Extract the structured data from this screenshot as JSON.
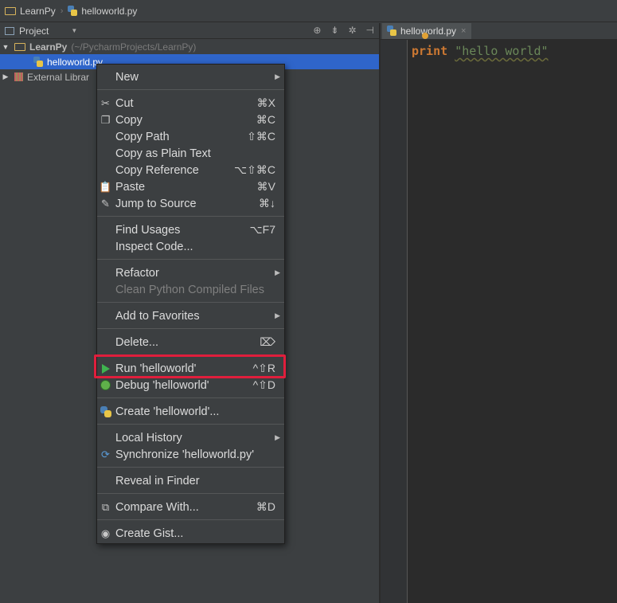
{
  "breadcrumb": {
    "project": "LearnPy",
    "file": "helloworld.py"
  },
  "project_panel": {
    "title": "Project",
    "tree": {
      "root_name": "LearnPy",
      "root_path": "(~/PycharmProjects/LearnPy)",
      "selected_file": "helloworld.py",
      "external_libraries": "External Librar"
    }
  },
  "editor": {
    "tab_label": "helloworld.py",
    "code": {
      "keyword": "print",
      "string": "\"hello world\""
    }
  },
  "context_menu": {
    "new": "New",
    "cut": {
      "label": "Cut",
      "shortcut": "⌘X"
    },
    "copy": {
      "label": "Copy",
      "shortcut": "⌘C"
    },
    "copy_path": {
      "label": "Copy Path",
      "shortcut": "⇧⌘C"
    },
    "copy_plain": {
      "label": "Copy as Plain Text"
    },
    "copy_reference": {
      "label": "Copy Reference",
      "shortcut": "⌥⇧⌘C"
    },
    "paste": {
      "label": "Paste",
      "shortcut": "⌘V"
    },
    "jump_to_source": {
      "label": "Jump to Source",
      "shortcut": "⌘↓"
    },
    "find_usages": {
      "label": "Find Usages",
      "shortcut": "⌥F7"
    },
    "inspect_code": {
      "label": "Inspect Code..."
    },
    "refactor": {
      "label": "Refactor"
    },
    "clean_compiled": {
      "label": "Clean Python Compiled Files"
    },
    "add_favorites": {
      "label": "Add to Favorites"
    },
    "delete": {
      "label": "Delete...",
      "shortcut": "⌦"
    },
    "run": {
      "label": "Run 'helloworld'",
      "shortcut": "^⇧R"
    },
    "debug": {
      "label": "Debug 'helloworld'",
      "shortcut": "^⇧D"
    },
    "create": {
      "label": "Create 'helloworld'..."
    },
    "local_history": {
      "label": "Local History"
    },
    "synchronize": {
      "label": "Synchronize 'helloworld.py'"
    },
    "reveal_finder": {
      "label": "Reveal in Finder"
    },
    "compare_with": {
      "label": "Compare With...",
      "shortcut": "⌘D"
    },
    "create_gist": {
      "label": "Create Gist..."
    }
  },
  "colors": {
    "highlight_box": "#e01e3c",
    "selection": "#2f65ca",
    "run_icon": "#3fb34f"
  }
}
